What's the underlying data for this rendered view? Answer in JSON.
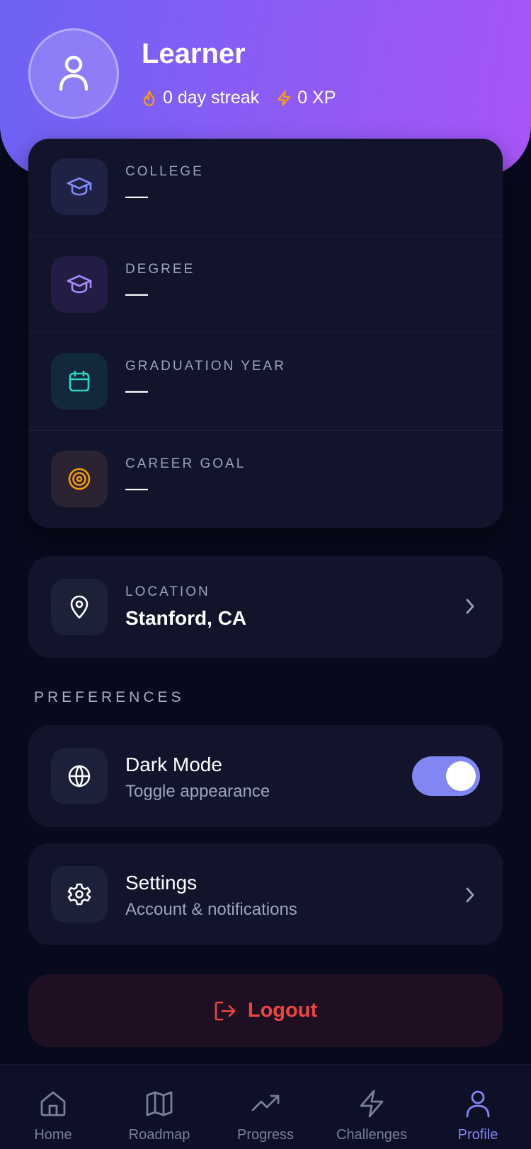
{
  "profile": {
    "name": "Learner",
    "streak": "0 day streak",
    "xp": "0 XP"
  },
  "info": [
    {
      "label": "COLLEGE",
      "value": "—",
      "icon": "graduation-cap-icon",
      "color": "#818cf8",
      "bg": "#1f2244"
    },
    {
      "label": "DEGREE",
      "value": "—",
      "icon": "graduation-cap-icon",
      "color": "#a78bfa",
      "bg": "#231d45"
    },
    {
      "label": "GRADUATION YEAR",
      "value": "—",
      "icon": "calendar-icon",
      "color": "#2dd4bf",
      "bg": "#11293a"
    },
    {
      "label": "CAREER GOAL",
      "value": "—",
      "icon": "target-icon",
      "color": "#f59e0b",
      "bg": "#2b2331"
    }
  ],
  "location": {
    "label": "LOCATION",
    "value": "Stanford, CA",
    "icon": "map-pin-icon"
  },
  "preferences": {
    "title": "PREFERENCES",
    "dark_mode": {
      "title": "Dark Mode",
      "subtitle": "Toggle appearance",
      "enabled": true,
      "icon": "globe-icon"
    },
    "settings": {
      "title": "Settings",
      "subtitle": "Account & notifications",
      "icon": "gear-icon"
    }
  },
  "logout": {
    "label": "Logout",
    "color": "#ef4444"
  },
  "nav": [
    {
      "label": "Home",
      "icon": "home-icon",
      "active": false
    },
    {
      "label": "Roadmap",
      "icon": "map-icon",
      "active": false
    },
    {
      "label": "Progress",
      "icon": "trending-up-icon",
      "active": false
    },
    {
      "label": "Challenges",
      "icon": "lightning-icon",
      "active": false
    },
    {
      "label": "Profile",
      "icon": "user-icon",
      "active": true
    }
  ],
  "colors": {
    "accent": "#8186f3",
    "streak": "#f59e0b",
    "background": "#070a1c",
    "card": "#12142b"
  }
}
